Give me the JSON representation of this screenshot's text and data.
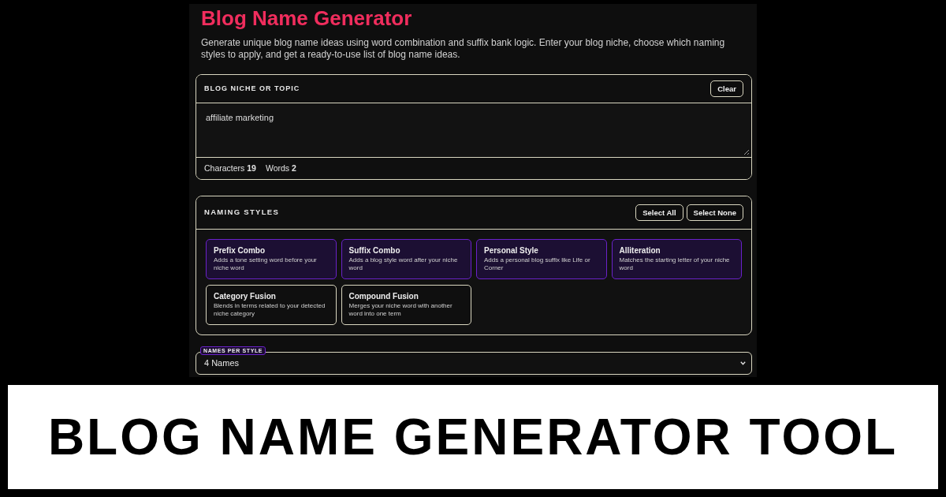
{
  "header": {
    "title": "Blog Name Generator",
    "description": "Generate unique blog name ideas using word combination and suffix bank logic. Enter your blog niche, choose which naming styles to apply, and get a ready-to-use list of blog name ideas."
  },
  "niche_card": {
    "label": "BLOG NICHE OR TOPIC",
    "clear_button": "Clear",
    "textarea": {
      "value": "affiliate marketing"
    },
    "stats": [
      "Characters **19**",
      "Words **2**"
    ]
  },
  "styles_card": {
    "label": "NAMING STYLES",
    "buttons": [
      "Select All",
      "Select None"
    ],
    "options": [
      {
        "title": "Prefix Combo",
        "description": "Adds a tone setting word before your niche word",
        "selected": true
      },
      {
        "title": "Suffix Combo",
        "description": "Adds a blog style word after your niche word",
        "selected": true
      },
      {
        "title": "Personal Style",
        "description": "Adds a personal blog suffix like Life or Corner",
        "selected": true
      },
      {
        "title": "Alliteration",
        "description": "Matches the starting letter of your niche word",
        "selected": true
      },
      {
        "title": "Category Fusion",
        "description": "Blends in terms related to your detected niche category",
        "selected": false
      },
      {
        "title": "Compound Fusion",
        "description": "Merges your niche word with another word into one term",
        "selected": false
      }
    ]
  },
  "names_per_style": {
    "label": "NAMES PER STYLE",
    "value": "4 Names"
  },
  "banner": {
    "text": "BLOG NAME GENERATOR TOOL"
  }
}
